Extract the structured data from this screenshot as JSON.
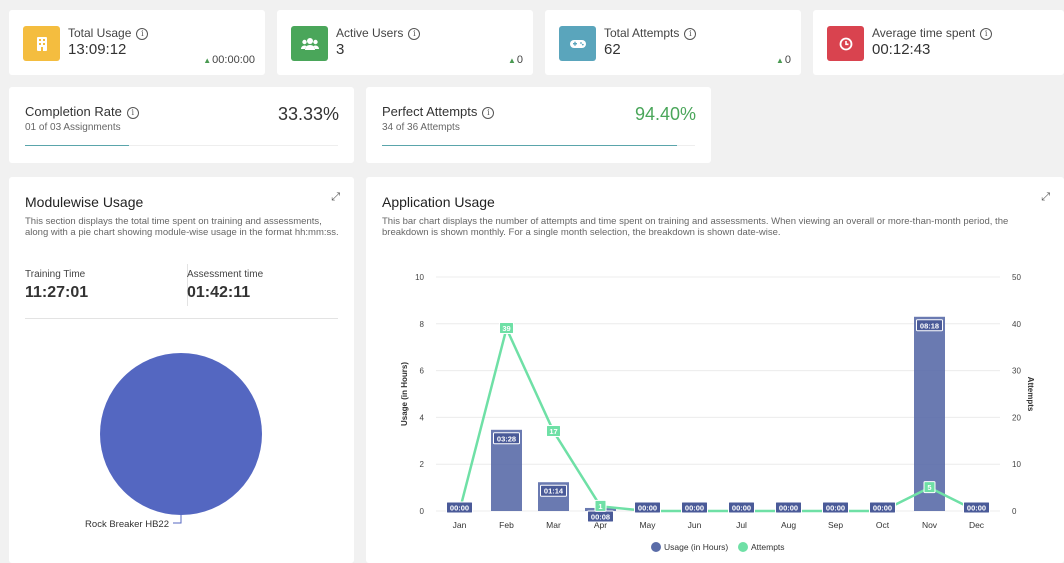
{
  "stats": [
    {
      "label": "Total Usage",
      "value": "13:09:12",
      "delta": "00:00:00",
      "color": "#f4bd3f",
      "icon": "building-icon"
    },
    {
      "label": "Active Users",
      "value": "3",
      "delta": "0",
      "color": "#4aa65a",
      "icon": "users-icon"
    },
    {
      "label": "Total Attempts",
      "value": "62",
      "delta": "0",
      "color": "#5aa5bc",
      "icon": "gamepad-icon"
    },
    {
      "label": "Average time spent",
      "value": "00:12:43",
      "delta": "",
      "color": "#d9434f",
      "icon": "clock-icon"
    }
  ],
  "completion": {
    "title": "Completion Rate",
    "sub": "01 of 03 Assignments",
    "pct": "33.33%",
    "progress": 0.3333
  },
  "perfect": {
    "title": "Perfect Attempts",
    "sub": "34 of 36 Attempts",
    "pct": "94.40%",
    "progress": 0.944,
    "color": "#4aa65a"
  },
  "modulewise": {
    "title": "Modulewise Usage",
    "desc": "This section displays the total time spent on training and assessments, along with a pie chart showing module-wise usage in the format hh:mm:ss.",
    "training_label": "Training Time",
    "training_value": "11:27:01",
    "assessment_label": "Assessment time",
    "assessment_value": "01:42:11",
    "pie_label": "Rock Breaker HB22",
    "pie_color": "#5467c1"
  },
  "application": {
    "title": "Application Usage",
    "desc": "This bar chart displays the number of attempts and time spent on training and assessments. When viewing an overall or more-than-month period, the breakdown is shown monthly. For a single month selection, the breakdown is shown date-wise."
  },
  "chart_data": {
    "type": "bar",
    "categories": [
      "Jan",
      "Feb",
      "Mar",
      "Apr",
      "May",
      "Jun",
      "Jul",
      "Aug",
      "Sep",
      "Oct",
      "Nov",
      "Dec"
    ],
    "series": [
      {
        "name": "Usage (in Hours)",
        "type": "bar",
        "values": [
          0,
          3.47,
          1.23,
          0.13,
          0,
          0,
          0,
          0,
          0,
          0,
          8.3,
          0
        ],
        "labels": [
          "00:00",
          "03:28",
          "01:14",
          "00:08",
          "00:00",
          "00:00",
          "00:00",
          "00:00",
          "00:00",
          "00:00",
          "08:18",
          "00:00"
        ],
        "color": "#5a6ca8"
      },
      {
        "name": "Attempts",
        "type": "line",
        "values": [
          0,
          39,
          17,
          1,
          0,
          0,
          0,
          0,
          0,
          0,
          5,
          0
        ],
        "color": "#6fe0a6"
      }
    ],
    "ylabel": "Usage (in Hours)",
    "y2label": "Attempts",
    "ylim": [
      0,
      10
    ],
    "y2lim": [
      0,
      50
    ],
    "yticks": [
      "0",
      "2",
      "4",
      "6",
      "8",
      "10"
    ],
    "y2ticks": [
      "0",
      "10",
      "20",
      "30",
      "40",
      "50"
    ],
    "legend": "bottom"
  }
}
